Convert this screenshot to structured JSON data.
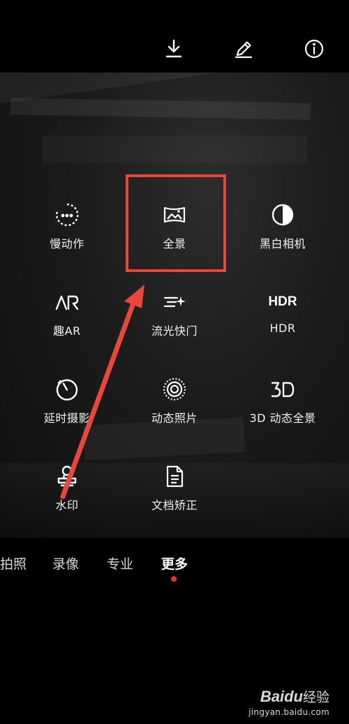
{
  "top_actions": {
    "download": "download-icon",
    "edit": "pencil-icon",
    "info": "info-icon"
  },
  "modes": [
    {
      "label": "慢动作",
      "icon": "slow-motion-icon"
    },
    {
      "label": "全景",
      "icon": "panorama-icon",
      "highlighted": true
    },
    {
      "label": "黑白相机",
      "icon": "monochrome-icon"
    },
    {
      "label": "趣AR",
      "icon": "ar-icon"
    },
    {
      "label": "流光快门",
      "icon": "light-painting-icon"
    },
    {
      "label": "HDR",
      "icon_text": "HDR"
    },
    {
      "label": "延时摄影",
      "icon": "time-lapse-icon"
    },
    {
      "label": "动态照片",
      "icon": "moving-picture-icon"
    },
    {
      "label": "3D 动态全景",
      "icon_text": "3D"
    },
    {
      "label": "水印",
      "icon": "watermark-icon"
    },
    {
      "label": "文档矫正",
      "icon": "document-icon"
    }
  ],
  "tabs": [
    {
      "label": "拍照"
    },
    {
      "label": "录像"
    },
    {
      "label": "专业"
    },
    {
      "label": "更多",
      "active": true
    }
  ],
  "annotation": {
    "box_color": "#e8473c",
    "arrow_color": "#e8473c"
  },
  "watermark": {
    "brand": "Baidu",
    "cn": "经验",
    "url": "jingyan.baidu.com"
  }
}
